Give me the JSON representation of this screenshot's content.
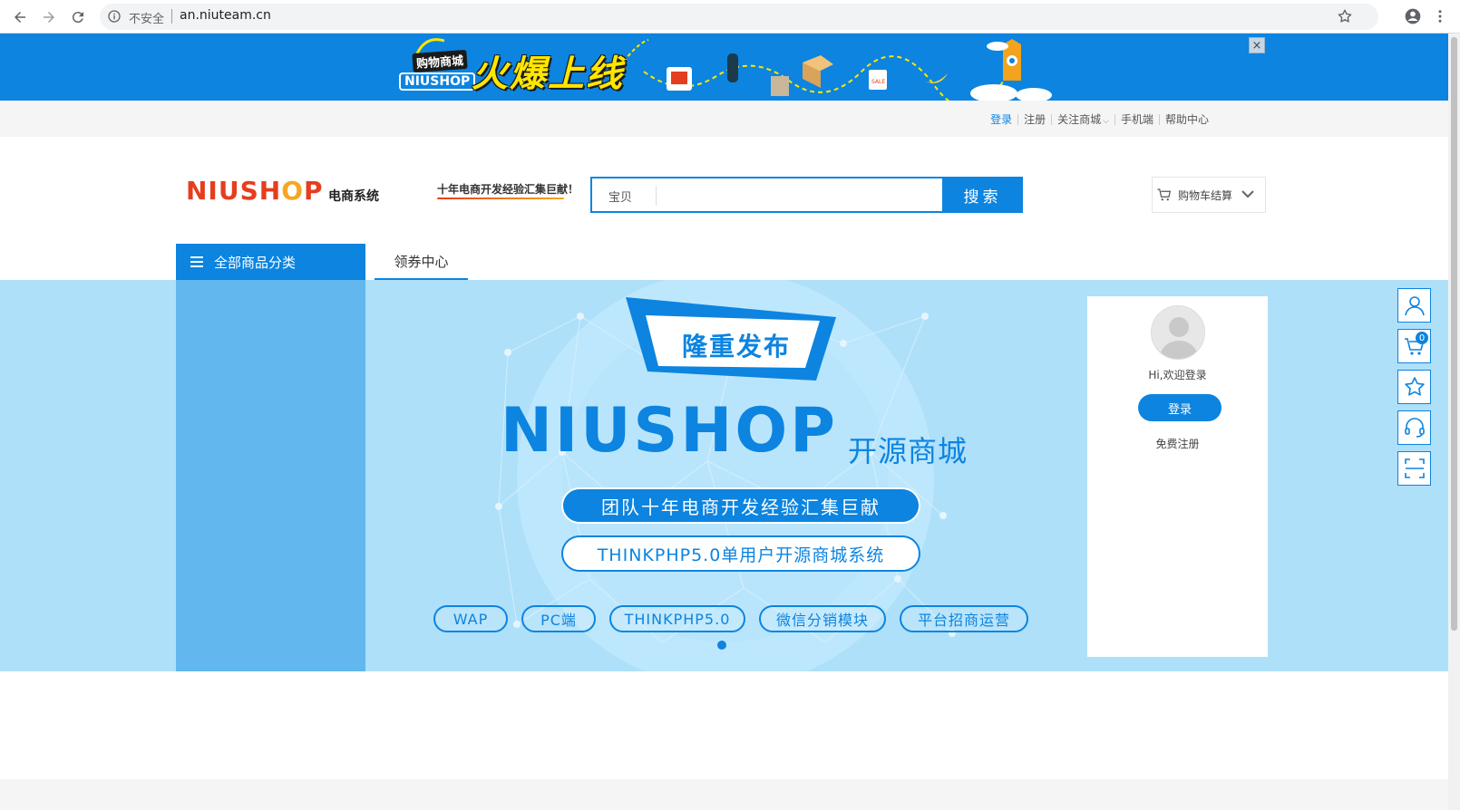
{
  "browser": {
    "insecure_label": "不安全",
    "url": "an.niuteam.cn"
  },
  "top_banner": {
    "small_label": "购物商城",
    "brand_label": "NIUSHOP",
    "headline": "火爆上线",
    "close_symbol": "×"
  },
  "top_links": {
    "login": "登录",
    "register": "注册",
    "follow": "关注商城",
    "mobile": "手机端",
    "help": "帮助中心"
  },
  "header": {
    "logo_main": "NIUSH",
    "logo_o": "O",
    "logo_p": "P",
    "logo_sub": "电商系统",
    "slogan": "十年电商开发经验汇集巨献！",
    "search_category": "宝贝",
    "search_value": "",
    "search_placeholder": "",
    "search_button": "搜索",
    "cart_label": "购物车结算"
  },
  "nav": {
    "all_categories": "全部商品分类",
    "tabs": [
      {
        "label": "领券中心"
      }
    ]
  },
  "hero": {
    "badge": "隆重发布",
    "brand": "NIUSHOP",
    "brand_sub": "开源商城",
    "pill_filled": "团队十年电商开发经验汇集巨献",
    "pill_outline": "THINKPHP5.0单用户开源商城系统",
    "tags": [
      "WAP",
      "PC端",
      "THINKPHP5.0",
      "微信分销模块",
      "平台招商运营"
    ]
  },
  "login_card": {
    "welcome": "Hi,欢迎登录",
    "login_button": "登录",
    "register_link": "免费注册"
  },
  "side_toolbar": {
    "cart_count": "0"
  },
  "colors": {
    "brand_blue": "#0c84e0",
    "hero_bg": "#aee0fa",
    "category_side": "#62b8ee",
    "logo_red": "#e53e1e",
    "banner_yellow": "#ffe600"
  }
}
